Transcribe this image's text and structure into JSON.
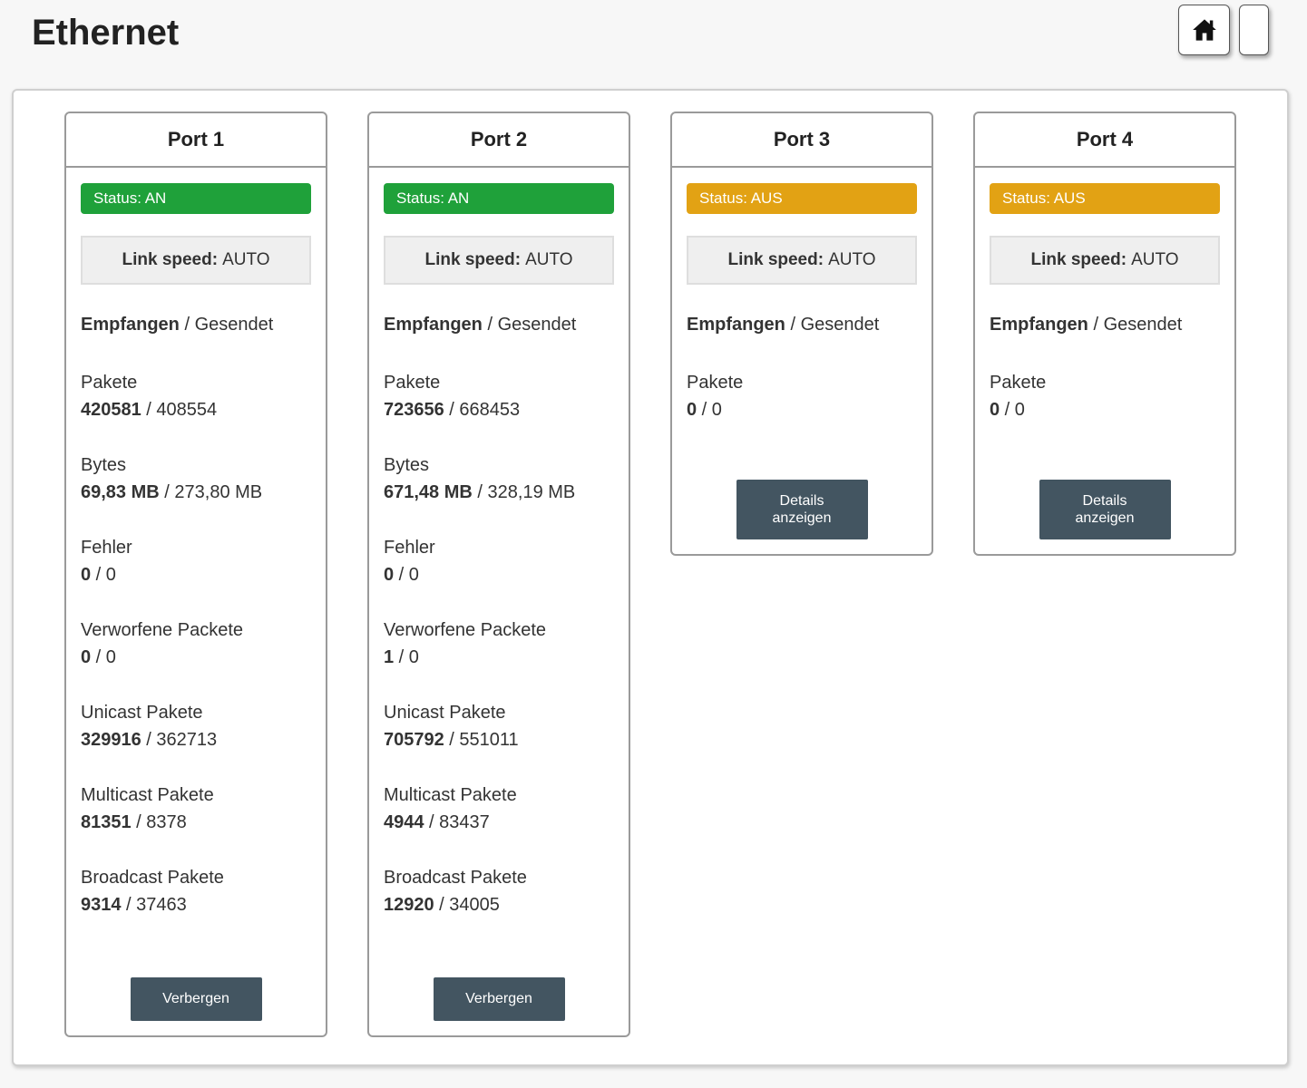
{
  "page": {
    "title": "Ethernet"
  },
  "labels": {
    "received": "Empfangen",
    "sent": "Gesendet",
    "link_speed": "Link speed:"
  },
  "ports": [
    {
      "name": "Port 1",
      "status": "Status: AN",
      "status_color": "#1fa13a",
      "link_speed": "AUTO",
      "stats": [
        {
          "label": "Pakete",
          "rx": "420581",
          "tx": "408554"
        },
        {
          "label": "Bytes",
          "rx": "69,83 MB",
          "tx": "273,80 MB"
        },
        {
          "label": "Fehler",
          "rx": "0",
          "tx": "0"
        },
        {
          "label": "Verworfene Packete",
          "rx": "0",
          "tx": "0"
        },
        {
          "label": "Unicast Pakete",
          "rx": "329916",
          "tx": "362713"
        },
        {
          "label": "Multicast Pakete",
          "rx": "81351",
          "tx": "8378"
        },
        {
          "label": "Broadcast Pakete",
          "rx": "9314",
          "tx": "37463"
        }
      ],
      "button": "Verbergen"
    },
    {
      "name": "Port 2",
      "status": "Status: AN",
      "status_color": "#1fa13a",
      "link_speed": "AUTO",
      "stats": [
        {
          "label": "Pakete",
          "rx": "723656",
          "tx": "668453"
        },
        {
          "label": "Bytes",
          "rx": "671,48 MB",
          "tx": "328,19 MB"
        },
        {
          "label": "Fehler",
          "rx": "0",
          "tx": "0"
        },
        {
          "label": "Verworfene Packete",
          "rx": "1",
          "tx": "0"
        },
        {
          "label": "Unicast Pakete",
          "rx": "705792",
          "tx": "551011"
        },
        {
          "label": "Multicast Pakete",
          "rx": "4944",
          "tx": "83437"
        },
        {
          "label": "Broadcast Pakete",
          "rx": "12920",
          "tx": "34005"
        }
      ],
      "button": "Verbergen"
    },
    {
      "name": "Port 3",
      "status": "Status: AUS",
      "status_color": "#e2a214",
      "link_speed": "AUTO",
      "stats": [
        {
          "label": "Pakete",
          "rx": "0",
          "tx": "0"
        }
      ],
      "button": "Details\nanzeigen"
    },
    {
      "name": "Port 4",
      "status": "Status: AUS",
      "status_color": "#e2a214",
      "link_speed": "AUTO",
      "stats": [
        {
          "label": "Pakete",
          "rx": "0",
          "tx": "0"
        }
      ],
      "button": "Details\nanzeigen"
    }
  ],
  "icons": {
    "home": "home-icon",
    "extra": "blank-button"
  }
}
